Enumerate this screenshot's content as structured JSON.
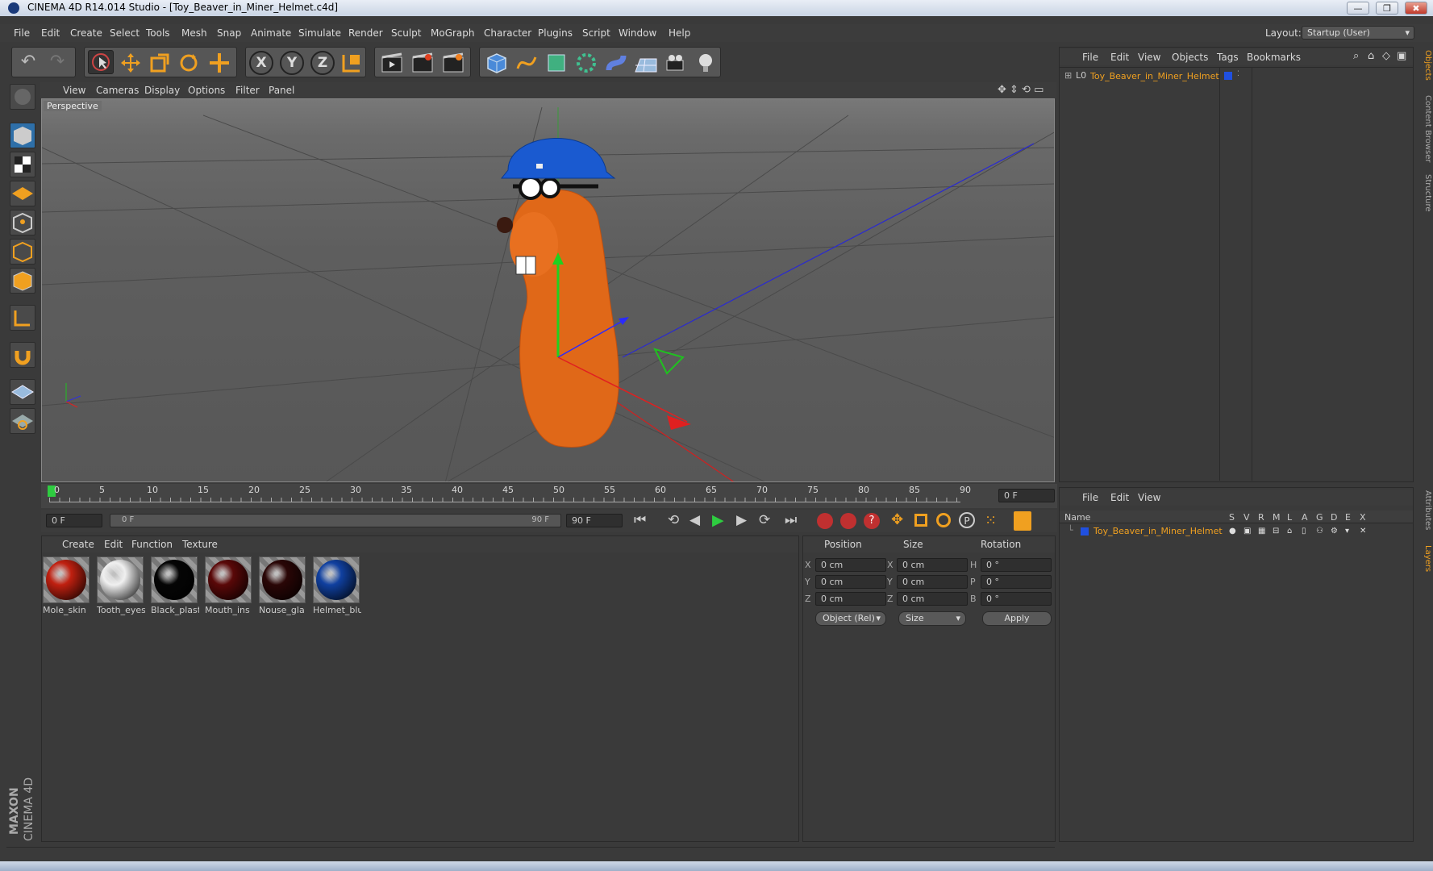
{
  "window": {
    "title": "CINEMA 4D R14.014 Studio - [Toy_Beaver_in_Miner_Helmet.c4d]",
    "controls": [
      "—",
      "❐",
      "✖"
    ]
  },
  "menubar": {
    "items": [
      "File",
      "Edit",
      "Create",
      "Select",
      "Tools",
      "Mesh",
      "Snap",
      "Animate",
      "Simulate",
      "Render",
      "Sculpt",
      "MoGraph",
      "Character",
      "Plugins",
      "Script",
      "Window",
      "Help"
    ],
    "layout_label": "Layout:",
    "layout_value": "Startup (User)"
  },
  "toolbar": {
    "axis_buttons": [
      "X",
      "Y",
      "Z"
    ]
  },
  "viewport": {
    "menu": [
      "View",
      "Cameras",
      "Display",
      "Options",
      "Filter",
      "Panel"
    ],
    "label": "Perspective"
  },
  "timeline": {
    "ticks": [
      "0",
      "5",
      "10",
      "15",
      "20",
      "25",
      "30",
      "35",
      "40",
      "45",
      "50",
      "55",
      "60",
      "65",
      "70",
      "75",
      "80",
      "85",
      "90"
    ],
    "current_frame": "0 F",
    "start_field": "0 F",
    "range_start": "0 F",
    "range_end": "90 F",
    "end_field": "90 F"
  },
  "materials": {
    "menu": [
      "Create",
      "Edit",
      "Function",
      "Texture"
    ],
    "items": [
      {
        "name": "Mole_skin",
        "color": "#c02010"
      },
      {
        "name": "Tooth_eyes",
        "color": "#f0f0f0"
      },
      {
        "name": "Black_plast",
        "color": "#050505"
      },
      {
        "name": "Mouth_ins",
        "color": "#5a0808"
      },
      {
        "name": "Nouse_gla",
        "color": "#2a0606"
      },
      {
        "name": "Helmet_blu",
        "color": "#1040a0"
      }
    ]
  },
  "coordinates": {
    "headers": [
      "Position",
      "Size",
      "Rotation"
    ],
    "rows": [
      {
        "pos_axis": "X",
        "pos": "0 cm",
        "size_axis": "X",
        "size": "0 cm",
        "rot_axis": "H",
        "rot": "0 °"
      },
      {
        "pos_axis": "Y",
        "pos": "0 cm",
        "size_axis": "Y",
        "size": "0 cm",
        "rot_axis": "P",
        "rot": "0 °"
      },
      {
        "pos_axis": "Z",
        "pos": "0 cm",
        "size_axis": "Z",
        "size": "0 cm",
        "rot_axis": "B",
        "rot": "0 °"
      }
    ],
    "mode_select": "Object (Rel)",
    "size_select": "Size",
    "apply_label": "Apply"
  },
  "objects_panel": {
    "menu": [
      "File",
      "Edit",
      "View",
      "Objects",
      "Tags",
      "Bookmarks"
    ],
    "object_name": "Toy_Beaver_in_Miner_Helmet"
  },
  "layers_panel": {
    "menu": [
      "File",
      "Edit",
      "View"
    ],
    "columns": [
      "Name",
      "S",
      "V",
      "R",
      "M",
      "L",
      "A",
      "G",
      "D",
      "E",
      "X"
    ],
    "layer_name": "Toy_Beaver_in_Miner_Helmet"
  },
  "side_tabs": [
    "Objects",
    "Content Browser",
    "Structure",
    "Attributes",
    "Layers"
  ],
  "brand": {
    "maxon": "MAXON",
    "product": "CINEMA 4D"
  },
  "colors": {
    "accent": "#f0a020",
    "object_color": "#2050e0"
  }
}
